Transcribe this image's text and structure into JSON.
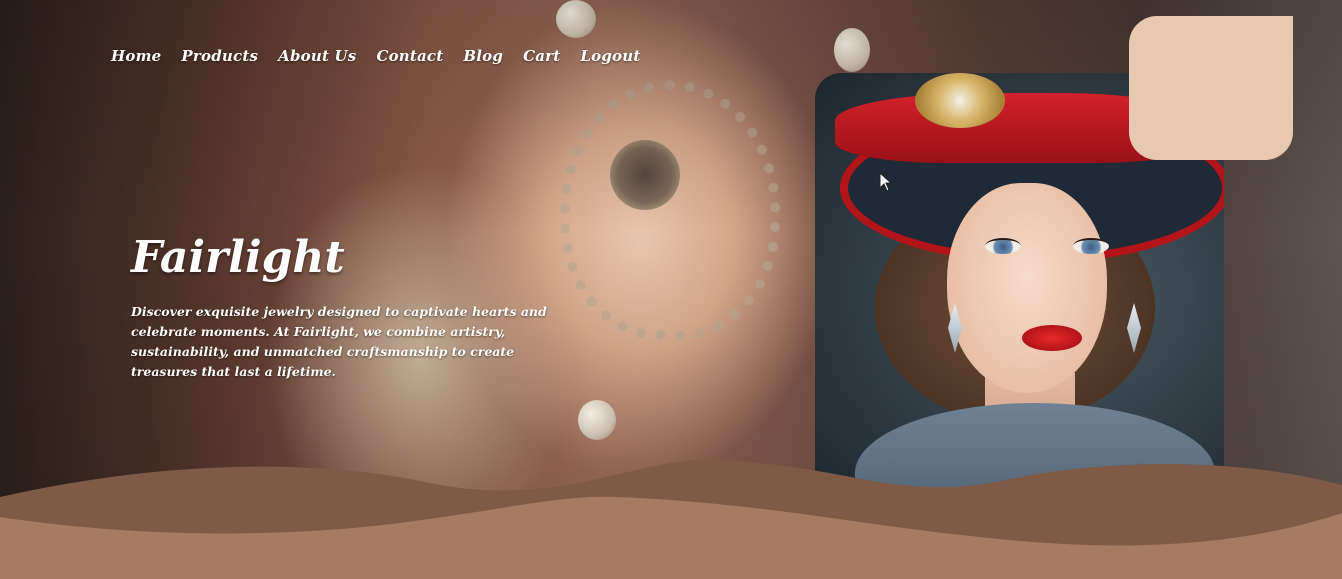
{
  "nav": {
    "items": [
      {
        "label": "Home"
      },
      {
        "label": "Products"
      },
      {
        "label": "About Us"
      },
      {
        "label": "Contact"
      },
      {
        "label": "Blog"
      },
      {
        "label": "Cart"
      },
      {
        "label": "Logout"
      }
    ]
  },
  "hero": {
    "brand": "Fairlight",
    "tagline": "Discover exquisite jewelry designed to captivate hearts and celebrate moments. At Fairlight, we combine artistry, sustainability, and unmatched craftsmanship to create treasures that last a lifetime."
  },
  "colors": {
    "wave_dark": "#7f5a46",
    "wave_light": "#a67b61",
    "corner_card": "#e7c9b1",
    "text": "#ffffff"
  }
}
